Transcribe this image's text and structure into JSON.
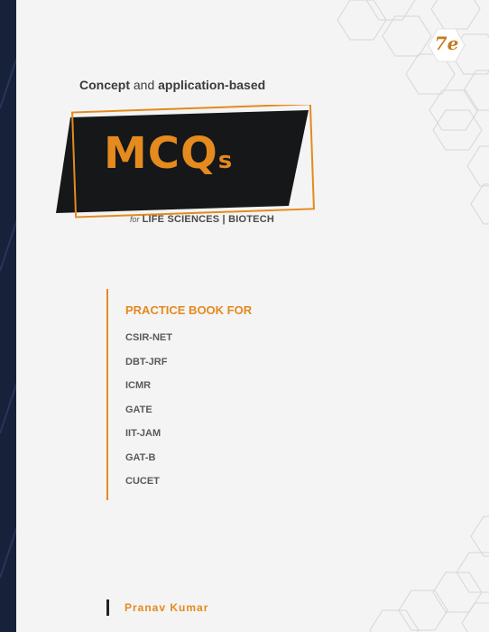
{
  "cover": {
    "edition": "7e",
    "tagline": {
      "part1": "Concept",
      "part2": " and ",
      "part3": "application-based"
    },
    "logo": {
      "main": "MCQ",
      "suffix": "s"
    },
    "subtitle": {
      "prefix": "for",
      "fields": "LIFE SCIENCES | BIOTECH"
    },
    "practice": {
      "title": "PRACTICE BOOK FOR",
      "exams": [
        "CSIR-NET",
        "DBT-JRF",
        "ICMR",
        "GATE",
        "IIT-JAM",
        "GAT-B",
        "CUCET"
      ]
    },
    "author": "Pranav Kumar"
  },
  "colors": {
    "accent": "#e48a1e",
    "logo_background": "#151719",
    "page": "#f4f4f4",
    "frame": "#17213a"
  }
}
